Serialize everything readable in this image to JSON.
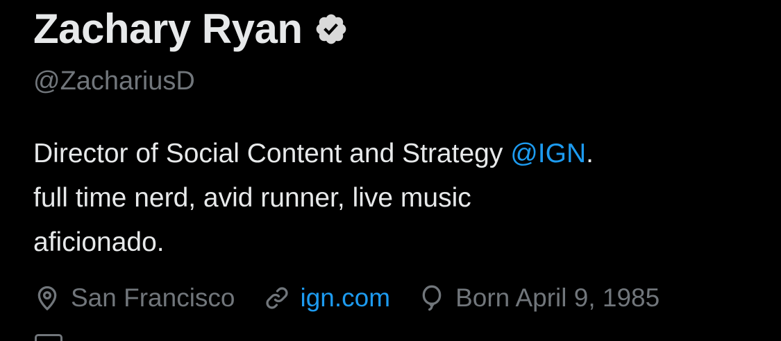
{
  "profile": {
    "display_name": "Zachary Ryan",
    "handle": "@ZachariusD",
    "verified_icon": "verified-badge-icon",
    "bio": {
      "line1_prefix": "Director of Social Content and Strategy ",
      "line1_mention": "@IGN",
      "line1_suffix": ".",
      "line2": "full time nerd, avid runner, live music",
      "line3": "aficionado."
    },
    "meta": {
      "location": "San Francisco",
      "website": "ign.com",
      "birthday": "Born April 9, 1985"
    }
  },
  "colors": {
    "background": "#000000",
    "primary_text": "#e7e9ea",
    "secondary_text": "#71767b",
    "accent": "#1d9bf0"
  },
  "icons": [
    "verified-badge-icon",
    "location-pin-icon",
    "link-icon",
    "balloon-icon",
    "calendar-icon"
  ]
}
